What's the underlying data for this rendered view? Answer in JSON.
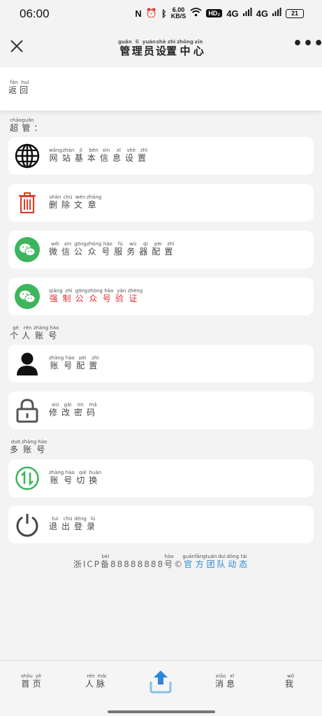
{
  "status_bar": {
    "time": "06:00",
    "network_speed_value": "6.00",
    "network_speed_unit": "KB/S",
    "hd_label": "HD₂",
    "signal1": "4G",
    "signal2": "4G",
    "battery": "21"
  },
  "nav": {
    "title_chars": [
      [
        "管",
        "guǎn"
      ],
      [
        "理",
        "lǐ"
      ],
      [
        "员",
        "yuán"
      ],
      [
        "设",
        "shè"
      ],
      [
        "置",
        "zhì"
      ],
      [
        "中",
        "zhōng"
      ],
      [
        "心",
        "xīn"
      ]
    ],
    "more_label": "•••"
  },
  "back": {
    "chars": [
      [
        "返",
        "fǎn"
      ],
      [
        "回",
        "huí"
      ]
    ]
  },
  "sections": {
    "super": {
      "chars": [
        [
          "超",
          "chāo"
        ],
        [
          "管",
          "guǎn"
        ],
        [
          "：",
          ""
        ]
      ]
    },
    "personal": {
      "chars": [
        [
          "个",
          "gè"
        ],
        [
          "人",
          "rén"
        ],
        [
          "账",
          "zhàng"
        ],
        [
          "号",
          "hào"
        ]
      ]
    },
    "multi": {
      "chars": [
        [
          "多",
          "duō"
        ],
        [
          "账",
          "zhàng"
        ],
        [
          "号",
          "hào"
        ]
      ]
    }
  },
  "items": [
    {
      "icon": "globe-icon",
      "chars": [
        [
          "网",
          "wǎng"
        ],
        [
          "站",
          "zhàn"
        ],
        [
          "基",
          "jī"
        ],
        [
          "本",
          "běn"
        ],
        [
          "信",
          "xìn"
        ],
        [
          "息",
          "xī"
        ],
        [
          "设",
          "shè"
        ],
        [
          "置",
          "zhì"
        ]
      ],
      "color": "#444444"
    },
    {
      "icon": "trash-icon",
      "chars": [
        [
          "删",
          "shān"
        ],
        [
          "除",
          "chú"
        ],
        [
          "文",
          "wén"
        ],
        [
          "章",
          "zhāng"
        ]
      ],
      "color": "#444444"
    },
    {
      "icon": "wechat-icon",
      "chars": [
        [
          "微",
          "wēi"
        ],
        [
          "信",
          "xìn"
        ],
        [
          "公",
          "gōng"
        ],
        [
          "众",
          "zhòng"
        ],
        [
          "号",
          "hào"
        ],
        [
          "服",
          "fú"
        ],
        [
          "务",
          "wù"
        ],
        [
          "器",
          "qì"
        ],
        [
          "配",
          "pèi"
        ],
        [
          "置",
          "zhì"
        ]
      ],
      "color": "#444444"
    },
    {
      "icon": "wechat-icon",
      "chars": [
        [
          "强",
          "qiáng"
        ],
        [
          "制",
          "zhì"
        ],
        [
          "公",
          "gōng"
        ],
        [
          "众",
          "zhòng"
        ],
        [
          "号",
          "hào"
        ],
        [
          "验",
          "yàn"
        ],
        [
          "证",
          "zhèng"
        ]
      ],
      "color": "#e23030"
    },
    {
      "icon": "user-icon",
      "chars": [
        [
          "账",
          "zhàng"
        ],
        [
          "号",
          "hào"
        ],
        [
          "配",
          "pèi"
        ],
        [
          "置",
          "zhì"
        ]
      ],
      "color": "#444444"
    },
    {
      "icon": "lock-icon",
      "chars": [
        [
          "修",
          "xiū"
        ],
        [
          "改",
          "gǎi"
        ],
        [
          "密",
          "mì"
        ],
        [
          "码",
          "mǎ"
        ]
      ],
      "color": "#444444"
    },
    {
      "icon": "switch-icon",
      "chars": [
        [
          "账",
          "zhàng"
        ],
        [
          "号",
          "hào"
        ],
        [
          "切",
          "qiē"
        ],
        [
          "换",
          "huàn"
        ]
      ],
      "color": "#444444"
    },
    {
      "icon": "power-icon",
      "chars": [
        [
          "退",
          "tuì"
        ],
        [
          "出",
          "chū"
        ],
        [
          "登",
          "dēng"
        ],
        [
          "录",
          "lù"
        ]
      ],
      "color": "#444444"
    }
  ],
  "footer": {
    "prefix_chars": [
      [
        "浙",
        ""
      ],
      [
        "ICP",
        ""
      ],
      [
        "备",
        "bèi"
      ],
      [
        "88888888",
        ""
      ],
      [
        "号",
        "hào"
      ],
      [
        "©",
        ""
      ]
    ],
    "team_chars": [
      [
        "官",
        "guān"
      ],
      [
        "方",
        "fāng"
      ],
      [
        "团",
        "tuán"
      ],
      [
        "队",
        "duì"
      ],
      [
        "动",
        "dòng"
      ],
      [
        "态",
        "tài"
      ]
    ]
  },
  "tabs": {
    "home": [
      [
        "首",
        "shǒu"
      ],
      [
        "页",
        "yè"
      ]
    ],
    "contacts": [
      [
        "人",
        "rén"
      ],
      [
        "脉",
        "mài"
      ]
    ],
    "messages": [
      [
        "消",
        "xiāo"
      ],
      [
        "息",
        "xī"
      ]
    ],
    "me": [
      [
        "我",
        "wǒ"
      ]
    ]
  },
  "colors": {
    "accent_green": "#3cb55c",
    "accent_red": "#e23030",
    "link_blue": "#2a8bd6",
    "share_blue": "#2f86d6"
  }
}
